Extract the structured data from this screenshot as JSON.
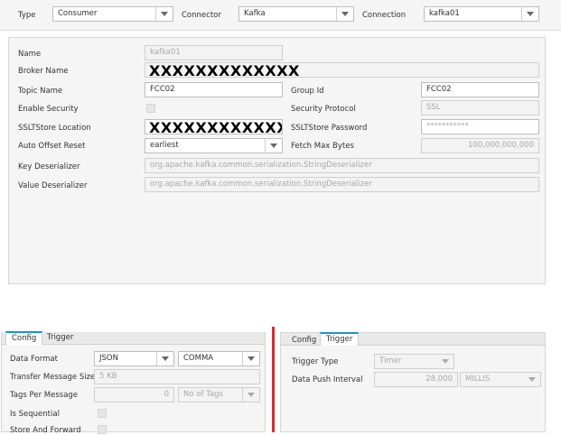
{
  "top_bar": {
    "type_label": "Type",
    "type_value": "Consumer",
    "connector_label": "Connector",
    "connector_value": "Kafka",
    "connection_label": "Connection",
    "connection_value": "kafka01"
  },
  "main_form": {
    "name_label": "Name",
    "name_value": "kafka01",
    "broker_label": "Broker Name",
    "broker_value": "XXXXXXXXXXXXX",
    "topic_label": "Topic Name",
    "topic_value": "FCC02",
    "group_label": "Group Id",
    "group_value": "FCC02",
    "enable_security_label": "Enable Security",
    "security_protocol_label": "Security Protocol",
    "security_protocol_value": "SSL",
    "ssl_location_label": "SSLTStore Location",
    "ssl_location_value": "XXXXXXXXXXXX",
    "ssl_password_label": "SSLTStore Password",
    "ssl_password_value": "***********",
    "offset_label": "Auto Offset Reset",
    "offset_value": "earliest",
    "fetch_label": "Fetch Max Bytes",
    "fetch_value": "100,000,000,000",
    "key_deser_label": "Key Deserializer",
    "key_deser_value": "org.apache.kafka.common.serialization.StringDeserializer",
    "value_deser_label": "Value Deserializer",
    "value_deser_value": "org.apache.kafka.common.serialization.StringDeserializer"
  },
  "left_panel": {
    "tabs": [
      "Config",
      "Trigger"
    ],
    "data_format_label": "Data Format",
    "data_format_value": "JSON",
    "delimiter_value": "COMMA",
    "transfer_size_label": "Transfer Message Size",
    "transfer_size_value": "5 KB",
    "tags_label": "Tags Per Message",
    "tags_value": "0",
    "tags_unit_value": "No of Tags",
    "sequential_label": "Is Sequential",
    "store_forward_label": "Store And Forward"
  },
  "right_panel": {
    "tabs": [
      "Config",
      "Trigger"
    ],
    "trigger_type_label": "Trigger Type",
    "trigger_type_value": "Timer",
    "push_interval_label": "Data Push Interval",
    "push_interval_value": "28,000",
    "push_unit_value": "MILLIS"
  },
  "colors": {
    "accent_tab": "#1e90d6",
    "divider_red": "#d32f2f"
  },
  "icons": [
    "chevron-down-icon"
  ]
}
